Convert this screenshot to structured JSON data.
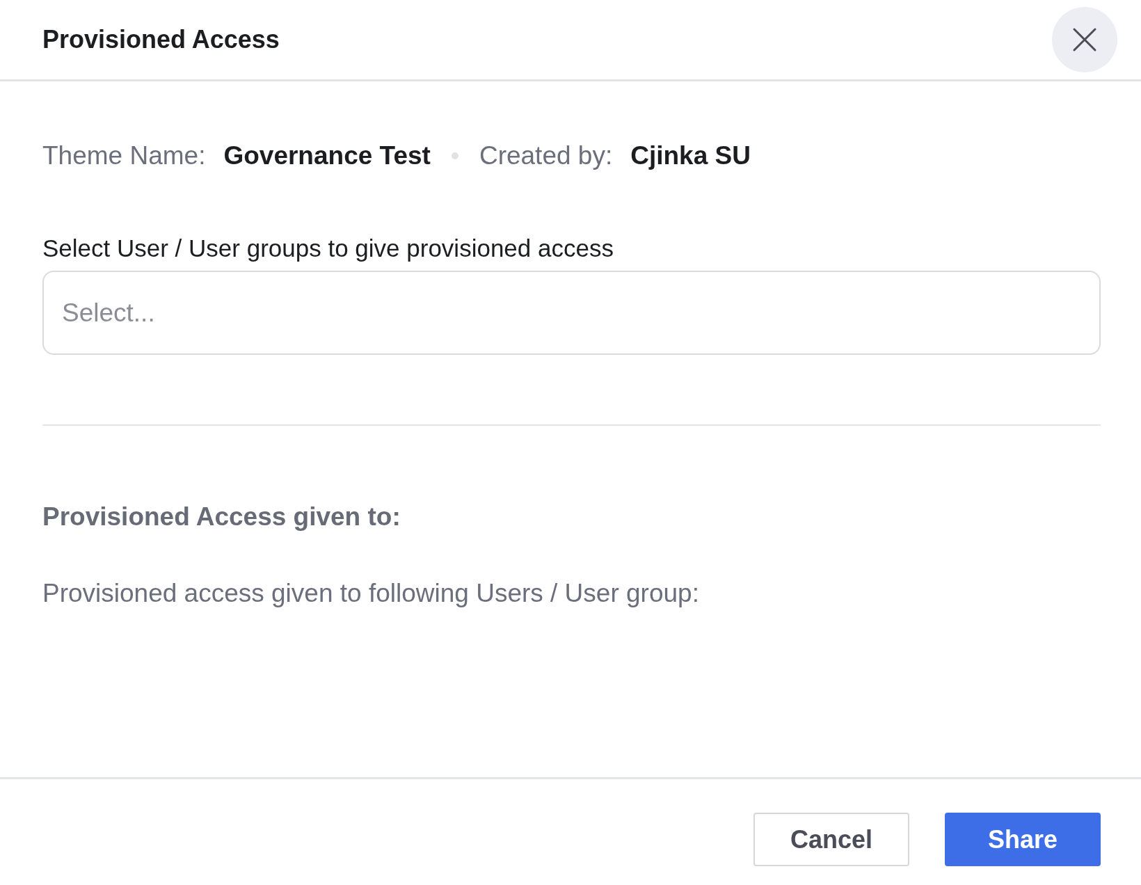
{
  "dialog": {
    "title": "Provisioned Access"
  },
  "meta": [
    {
      "label": "Theme Name:",
      "value": "Governance Test"
    },
    {
      "label": "Created by:",
      "value": "Cjinka SU"
    }
  ],
  "select": {
    "label": "Select User / User groups to give provisioned access",
    "placeholder": "Select..."
  },
  "given": {
    "heading": "Provisioned Access given to:",
    "text": "Provisioned access given to following Users / User group:"
  },
  "buttons": [
    {
      "label": "Cancel",
      "kind": "secondary"
    },
    {
      "label": "Share",
      "kind": "primary"
    }
  ]
}
